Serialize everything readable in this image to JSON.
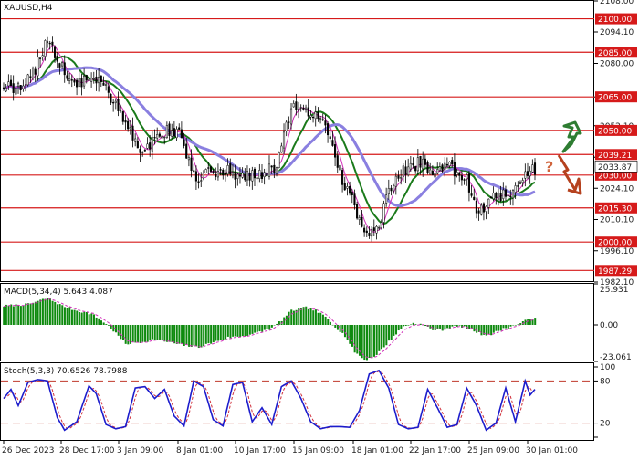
{
  "chart_data": [
    {
      "type": "candlestick",
      "title": "XAUUSD,H4",
      "ylim": [
        1982.1,
        2108.0
      ],
      "y_ticks": [
        "2108.00",
        "2094.10",
        "2080.00",
        "2065.00",
        "2052.10",
        "2038.00",
        "2024.10",
        "2010.10",
        "1996.10",
        "1982.10"
      ],
      "levels": [
        {
          "label": "2100.00",
          "value": 2100.0
        },
        {
          "label": "2085.00",
          "value": 2085.0
        },
        {
          "label": "2065.00",
          "value": 2065.0
        },
        {
          "label": "2050.00",
          "value": 2050.0
        },
        {
          "label": "2039.21",
          "value": 2039.21
        },
        {
          "label": "2030.00",
          "value": 2030.0
        },
        {
          "label": "2015.30",
          "value": 2015.3
        },
        {
          "label": "2000.00",
          "value": 2000.0
        },
        {
          "label": "1987.29",
          "value": 1987.29
        }
      ],
      "current_price_label": "2033.87",
      "current_price": 2033.87,
      "x_labels": [
        "26 Dec 2023",
        "28 Dec 17:00",
        "3 Jan 09:00",
        "8 Jan 01:00",
        "10 Jan 17:00",
        "15 Jan 09:00",
        "18 Jan 01:00",
        "22 Jan 17:00",
        "25 Jan 09:00",
        "30 Jan 01:00"
      ],
      "price_anchors": [
        [
          0,
          2070
        ],
        [
          8,
          2068
        ],
        [
          14,
          2080
        ],
        [
          18,
          2092
        ],
        [
          22,
          2080
        ],
        [
          30,
          2070
        ],
        [
          38,
          2074
        ],
        [
          46,
          2062
        ],
        [
          52,
          2050
        ],
        [
          56,
          2038
        ],
        [
          62,
          2046
        ],
        [
          68,
          2050
        ],
        [
          72,
          2048
        ],
        [
          76,
          2036
        ],
        [
          80,
          2028
        ],
        [
          84,
          2032
        ],
        [
          90,
          2032
        ],
        [
          96,
          2030
        ],
        [
          104,
          2030
        ],
        [
          112,
          2034
        ],
        [
          118,
          2060
        ],
        [
          124,
          2058
        ],
        [
          130,
          2054
        ],
        [
          134,
          2048
        ],
        [
          138,
          2030
        ],
        [
          142,
          2022
        ],
        [
          146,
          2008
        ],
        [
          150,
          2003
        ],
        [
          154,
          2008
        ],
        [
          158,
          2022
        ],
        [
          162,
          2030
        ],
        [
          168,
          2034
        ],
        [
          172,
          2036
        ],
        [
          176,
          2028
        ],
        [
          180,
          2034
        ],
        [
          186,
          2032
        ],
        [
          190,
          2028
        ],
        [
          194,
          2016
        ],
        [
          198,
          2016
        ],
        [
          202,
          2022
        ],
        [
          206,
          2020
        ],
        [
          210,
          2024
        ],
        [
          214,
          2032
        ],
        [
          218,
          2033
        ]
      ],
      "moving_averages": [
        {
          "color": "#1a7a1a",
          "period": 50
        },
        {
          "color": "#8a7fe0",
          "period": 100
        },
        {
          "color": "#d12fb9",
          "period": 20
        }
      ],
      "scenario_arrows": {
        "up_color": "#2e7d32",
        "down_color": "#b5411e",
        "question_mark": "?",
        "question_color": "#d0643c"
      }
    },
    {
      "type": "histogram",
      "title": "MACD(5,34,4) 5.643 4.087",
      "ylim": [
        -23.061,
        25.931
      ],
      "y_ticks": [
        "25.931",
        "0.00",
        "-23.061"
      ],
      "bar_color": "#0e8a0e",
      "signal_color": "#d12fb9",
      "anchors": [
        [
          0,
          12
        ],
        [
          10,
          13
        ],
        [
          18,
          17
        ],
        [
          24,
          12
        ],
        [
          30,
          9
        ],
        [
          36,
          7
        ],
        [
          40,
          3
        ],
        [
          44,
          -2
        ],
        [
          50,
          -12
        ],
        [
          56,
          -11
        ],
        [
          62,
          -9
        ],
        [
          68,
          -11
        ],
        [
          74,
          -13
        ],
        [
          80,
          -14
        ],
        [
          86,
          -11
        ],
        [
          92,
          -8
        ],
        [
          98,
          -7
        ],
        [
          104,
          -5
        ],
        [
          110,
          -2
        ],
        [
          114,
          3
        ],
        [
          118,
          9
        ],
        [
          124,
          11
        ],
        [
          128,
          9
        ],
        [
          132,
          5
        ],
        [
          136,
          -1
        ],
        [
          140,
          -7
        ],
        [
          144,
          -17
        ],
        [
          148,
          -22
        ],
        [
          152,
          -20
        ],
        [
          156,
          -14
        ],
        [
          160,
          -7
        ],
        [
          164,
          -1
        ],
        [
          168,
          1
        ],
        [
          172,
          0
        ],
        [
          176,
          -3
        ],
        [
          180,
          -3
        ],
        [
          184,
          -1
        ],
        [
          188,
          -1
        ],
        [
          192,
          -3
        ],
        [
          196,
          -6
        ],
        [
          200,
          -6
        ],
        [
          204,
          -3
        ],
        [
          208,
          -1
        ],
        [
          212,
          1
        ],
        [
          216,
          4
        ],
        [
          218,
          5
        ]
      ]
    },
    {
      "type": "line",
      "title": "Stoch(5,3,3) 70.6526 78.7988",
      "ylim": [
        0,
        100
      ],
      "y_ticks": [
        "100",
        "80",
        "20",
        "0"
      ],
      "levels": [
        80,
        20
      ],
      "series": [
        {
          "color": "#1c1ccc"
        },
        {
          "color": "#d12f3a"
        }
      ],
      "anchors": [
        [
          0,
          55
        ],
        [
          3,
          68
        ],
        [
          6,
          45
        ],
        [
          10,
          78
        ],
        [
          14,
          82
        ],
        [
          18,
          80
        ],
        [
          22,
          28
        ],
        [
          25,
          10
        ],
        [
          30,
          22
        ],
        [
          35,
          73
        ],
        [
          38,
          62
        ],
        [
          42,
          18
        ],
        [
          46,
          12
        ],
        [
          50,
          15
        ],
        [
          54,
          70
        ],
        [
          58,
          72
        ],
        [
          62,
          55
        ],
        [
          66,
          68
        ],
        [
          70,
          30
        ],
        [
          74,
          16
        ],
        [
          78,
          80
        ],
        [
          82,
          72
        ],
        [
          86,
          25
        ],
        [
          90,
          16
        ],
        [
          94,
          75
        ],
        [
          98,
          78
        ],
        [
          102,
          22
        ],
        [
          106,
          42
        ],
        [
          110,
          18
        ],
        [
          114,
          72
        ],
        [
          118,
          80
        ],
        [
          122,
          55
        ],
        [
          126,
          22
        ],
        [
          130,
          12
        ],
        [
          134,
          15
        ],
        [
          138,
          15
        ],
        [
          142,
          14
        ],
        [
          146,
          38
        ],
        [
          150,
          90
        ],
        [
          154,
          95
        ],
        [
          158,
          70
        ],
        [
          162,
          18
        ],
        [
          166,
          12
        ],
        [
          170,
          14
        ],
        [
          174,
          68
        ],
        [
          178,
          42
        ],
        [
          182,
          14
        ],
        [
          186,
          18
        ],
        [
          190,
          70
        ],
        [
          194,
          45
        ],
        [
          198,
          10
        ],
        [
          202,
          20
        ],
        [
          206,
          70
        ],
        [
          210,
          22
        ],
        [
          214,
          80
        ],
        [
          216,
          60
        ],
        [
          218,
          68
        ]
      ]
    }
  ]
}
